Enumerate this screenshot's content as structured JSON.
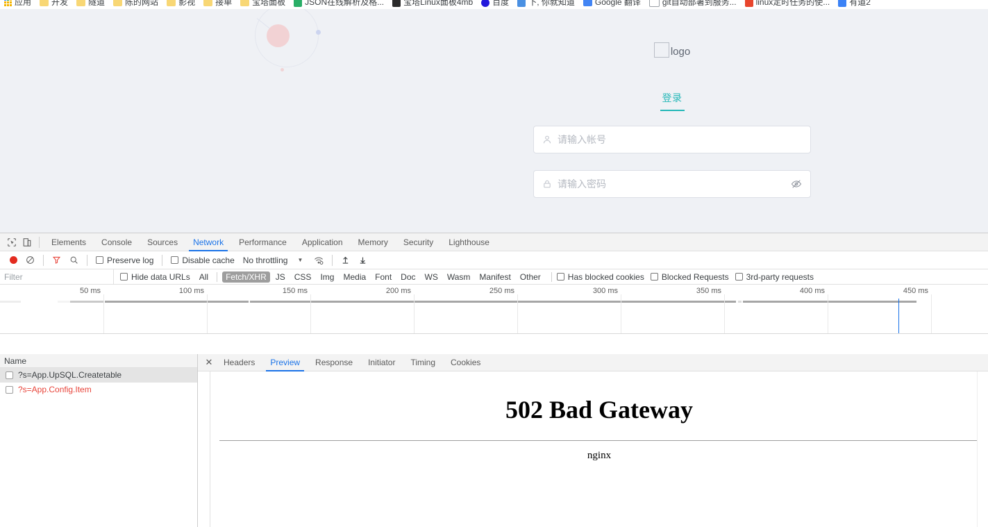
{
  "browser": {
    "bookmarks": [
      {
        "label": "应用",
        "icon": "apps-grid-icon"
      },
      {
        "label": "开发",
        "icon": "folder-icon"
      },
      {
        "label": "隧道",
        "icon": "folder-icon"
      },
      {
        "label": "陈的网站",
        "icon": "folder-icon"
      },
      {
        "label": "影视",
        "icon": "folder-icon"
      },
      {
        "label": "接单",
        "icon": "folder-icon"
      },
      {
        "label": "宝塔面板",
        "icon": "folder-icon"
      },
      {
        "label": "JSON在线解析及格...",
        "icon": "green-square-icon"
      },
      {
        "label": "宝塔Linux面板4mb",
        "icon": "dark-square-icon"
      },
      {
        "label": "百度",
        "icon": "baidu-icon"
      },
      {
        "label": "下, 你就知道",
        "icon": "blue-square-icon"
      },
      {
        "label": "Google 翻译",
        "icon": "google-translate-icon"
      },
      {
        "label": "git自动部署到服务...",
        "icon": "git-icon"
      },
      {
        "label": "linux定时任务的使...",
        "icon": "red-square-icon"
      },
      {
        "label": "有道2",
        "icon": "bluebird-icon"
      }
    ]
  },
  "page": {
    "logo": {
      "text": "logo"
    },
    "tab_label": "登录",
    "accent_color": "#23b7b7",
    "background_color": "#eff1f5",
    "fields": [
      {
        "name": "account",
        "placeholder": "请输入帐号",
        "value": "",
        "icon": "user-icon"
      },
      {
        "name": "password",
        "placeholder": "请输入密码",
        "value": "",
        "icon": "lock-icon",
        "trailing_icon": "eye-slash-icon"
      }
    ]
  },
  "devtools": {
    "tabs": [
      {
        "label": "Elements",
        "active": false
      },
      {
        "label": "Console",
        "active": false
      },
      {
        "label": "Sources",
        "active": false
      },
      {
        "label": "Network",
        "active": true
      },
      {
        "label": "Performance",
        "active": false
      },
      {
        "label": "Application",
        "active": false
      },
      {
        "label": "Memory",
        "active": false
      },
      {
        "label": "Security",
        "active": false
      },
      {
        "label": "Lighthouse",
        "active": false
      }
    ],
    "toolbar": {
      "record_label": "record-button",
      "clear_label": "clear-button",
      "filter_label": "filter-button",
      "search_label": "search-button",
      "preserve_log": "Preserve log",
      "disable_cache": "Disable cache",
      "throttling": "No throttling"
    },
    "filterbar": {
      "filter_placeholder": "Filter",
      "hide_data_urls": "Hide data URLs",
      "types": [
        {
          "label": "All",
          "active": false
        },
        {
          "label": "Fetch/XHR",
          "active": true
        },
        {
          "label": "JS",
          "active": false
        },
        {
          "label": "CSS",
          "active": false
        },
        {
          "label": "Img",
          "active": false
        },
        {
          "label": "Media",
          "active": false
        },
        {
          "label": "Font",
          "active": false
        },
        {
          "label": "Doc",
          "active": false
        },
        {
          "label": "WS",
          "active": false
        },
        {
          "label": "Wasm",
          "active": false
        },
        {
          "label": "Manifest",
          "active": false
        },
        {
          "label": "Other",
          "active": false
        }
      ],
      "has_blocked_cookies": "Has blocked cookies",
      "blocked_requests": "Blocked Requests",
      "third_party_requests": "3rd-party requests"
    },
    "timeline": {
      "ticks": [
        "50 ms",
        "100 ms",
        "150 ms",
        "200 ms",
        "250 ms",
        "300 ms",
        "350 ms",
        "400 ms",
        "450 ms"
      ],
      "marker_ms": 450
    },
    "requests": {
      "column_header": "Name",
      "rows": [
        {
          "name": "?s=App.UpSQL.Createtable",
          "state": "selected",
          "error": false
        },
        {
          "name": "?s=App.Config.Item",
          "state": "normal",
          "error": true
        }
      ]
    },
    "detail": {
      "tabs": [
        {
          "label": "Headers",
          "active": false
        },
        {
          "label": "Preview",
          "active": true
        },
        {
          "label": "Response",
          "active": false
        },
        {
          "label": "Initiator",
          "active": false
        },
        {
          "label": "Timing",
          "active": false
        },
        {
          "label": "Cookies",
          "active": false
        }
      ],
      "preview": {
        "title": "502 Bad Gateway",
        "server": "nginx"
      }
    }
  }
}
